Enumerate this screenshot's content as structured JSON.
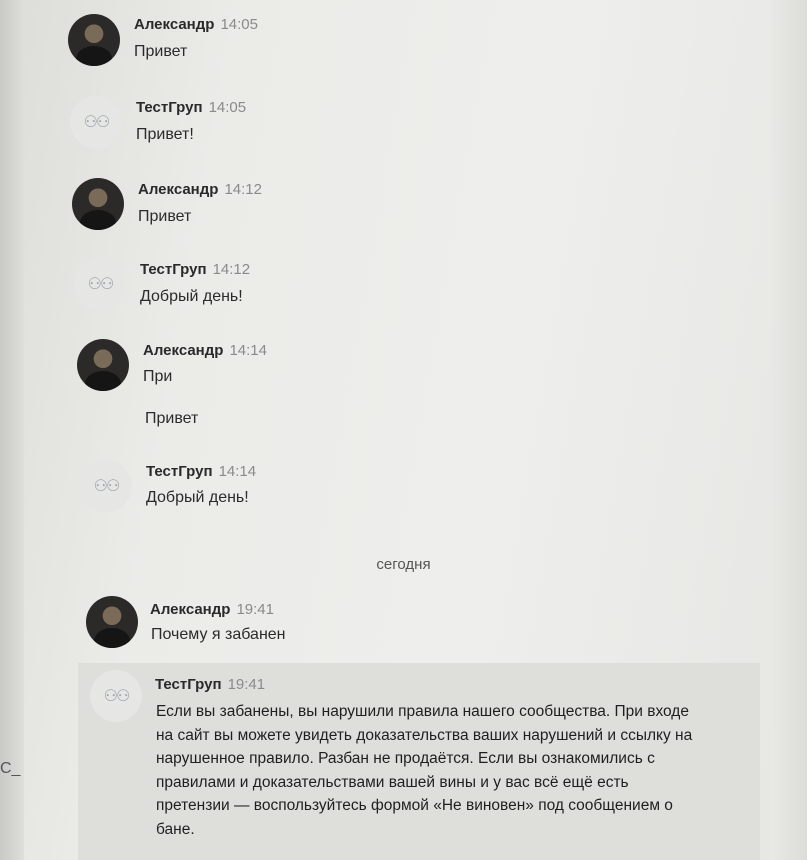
{
  "messages": [
    {
      "author": "Александр",
      "time": "14:05",
      "text": "Привет"
    },
    {
      "author": "ТестГруп",
      "time": "14:05",
      "text": "Привет!"
    },
    {
      "author": "Александр",
      "time": "14:12",
      "text": "Привет"
    },
    {
      "author": "ТестГруп",
      "time": "14:12",
      "text": "Добрый день!"
    },
    {
      "author": "Александр",
      "time": "14:14",
      "text": "При",
      "text2": "Привет"
    },
    {
      "author": "ТестГруп",
      "time": "14:14",
      "text": "Добрый день!"
    },
    {
      "author": "Александр",
      "time": "19:41",
      "text": "Почему я забанен"
    },
    {
      "author": "ТестГруп",
      "time": "19:41",
      "text": "Если вы забанены, вы нарушили правила нашего сообщества. При входе на сайт вы можете увидеть доказательства ваших нарушений и ссылку на нарушенное правило. Разбан не продаётся. Если вы ознакомились с правилами и доказательствами вашей вины и у вас всё ещё есть претензии — воспользуйтесь формой «Не виновен» под сообщением о бане."
    }
  ],
  "date_separator": "сегодня",
  "edge_glyph": "C_",
  "icons": {
    "user_avatar": "user-photo-avatar",
    "group_avatar": "group-icon"
  }
}
